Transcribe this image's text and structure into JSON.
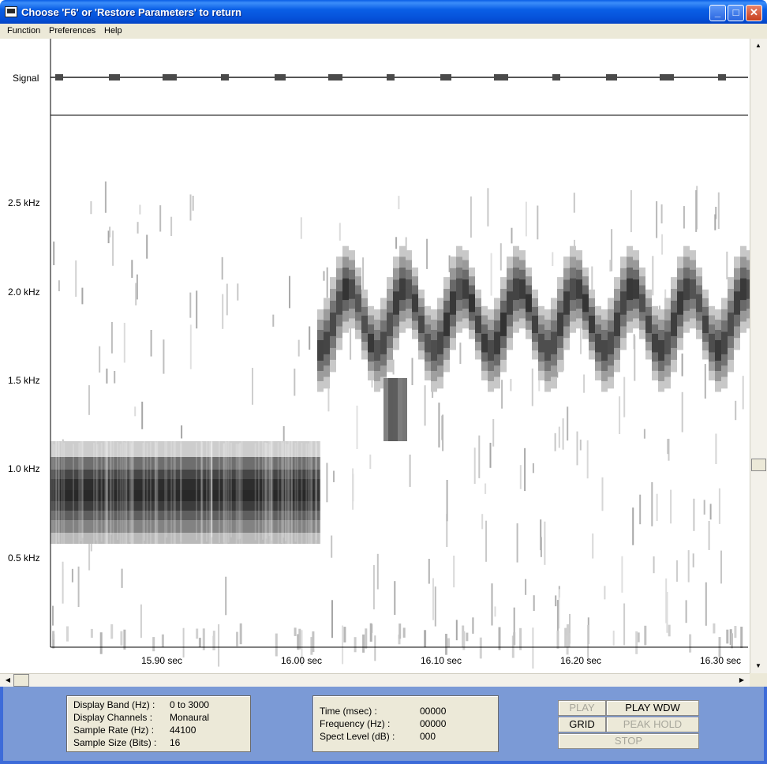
{
  "window": {
    "title": "Choose 'F6' or 'Restore Parameters' to return"
  },
  "menu": {
    "items": [
      "Function",
      "Preferences",
      "Help"
    ]
  },
  "plot": {
    "signal_label": "Signal",
    "y_labels": [
      "2.5 kHz",
      "2.0 kHz",
      "1.5 kHz",
      "1.0 kHz",
      "0.5 kHz"
    ],
    "x_labels": [
      "15.90 sec",
      "16.00 sec",
      "16.10 sec",
      "16.20 sec",
      "16.30 sec"
    ]
  },
  "info": {
    "display_band_label": "Display Band (Hz) :",
    "display_band_value": "0 to 3000",
    "display_channels_label": "Display Channels :",
    "display_channels_value": "Monaural",
    "sample_rate_label": "Sample Rate (Hz) :",
    "sample_rate_value": "44100",
    "sample_size_label": "Sample Size (Bits) :",
    "sample_size_value": "16"
  },
  "readout": {
    "time_label": "Time (msec) :",
    "time_value": "00000",
    "frequency_label": "Frequency (Hz) :",
    "frequency_value": "00000",
    "spect_level_label": "Spect Level (dB) :",
    "spect_level_value": "000"
  },
  "controls": {
    "play": "PLAY",
    "play_wdw": "PLAY WDW",
    "grid": "GRID",
    "peak_hold": "PEAK HOLD",
    "stop": "STOP"
  }
}
